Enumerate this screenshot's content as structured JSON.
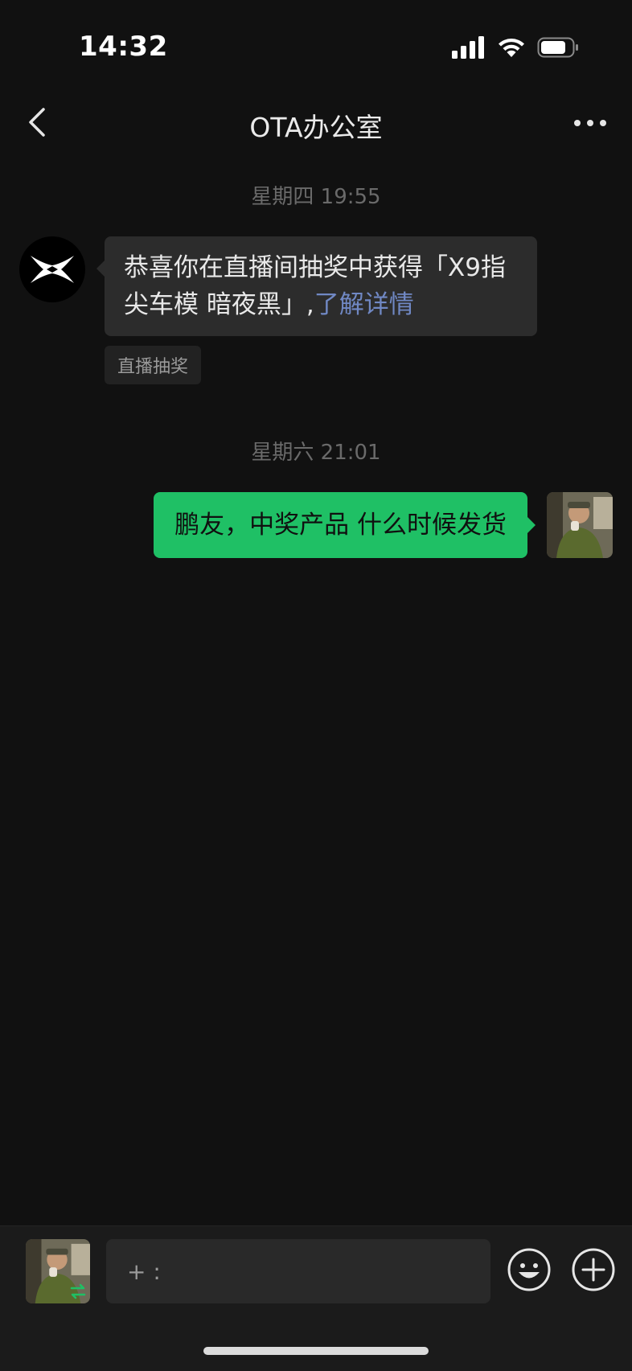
{
  "status_bar": {
    "time": "14:32",
    "icons": [
      "cellular-signal-icon",
      "wifi-icon",
      "battery-icon"
    ]
  },
  "nav": {
    "title": "OTA办公室",
    "back_icon": "chevron-left-icon",
    "more_icon": "more-dots-icon"
  },
  "messages": {
    "ts1": "星期四 19:55",
    "incoming": {
      "avatar": "xpeng-logo-avatar",
      "text": "恭喜你在直播间抽奖中获得「X9指尖车模 暗夜黑」,",
      "link": "了解详情",
      "tag": "直播抽奖"
    },
    "ts2": "星期六 21:01",
    "outgoing": {
      "text": "鹏友，中奖产品 什么时候发货",
      "avatar": "user-photo-avatar"
    }
  },
  "input_bar": {
    "placeholder": "+ :",
    "value": "",
    "switch_icon": "swap-arrows-icon",
    "emoji_icon": "smiley-icon",
    "plus_icon": "plus-circle-icon"
  },
  "colors": {
    "background": "#111111",
    "incoming_bubble": "#2c2c2c",
    "outgoing_bubble": "#1fc065",
    "link": "#7088c4",
    "timestamp": "#6a6a6a"
  }
}
